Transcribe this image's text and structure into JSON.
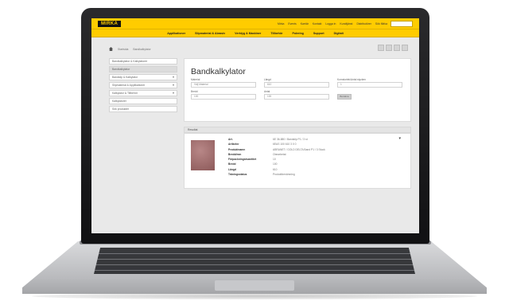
{
  "header": {
    "logo": "MIRKA",
    "top_links": [
      "Mirka",
      "Events",
      "Karriär",
      "Kontakt",
      "Logga in",
      "Kundtjänst",
      "Distributörer",
      "Sök Mirka"
    ],
    "accent_color": "#ffcc00"
  },
  "nav": {
    "items": [
      "Applikationer",
      "Slipmaterial & Abrasiv",
      "Verktyg & Maskiner",
      "Tillbehör",
      "Polering",
      "Support",
      "Digitalt"
    ]
  },
  "breadcrumb": [
    "Startsida",
    "Bandkalkylator"
  ],
  "sidebar": {
    "items": [
      {
        "label": "Bandkalkylator & Kalkylatorer",
        "chevron": false,
        "active": false
      },
      {
        "label": "Bandkalkylator",
        "chevron": false,
        "active": true
      },
      {
        "label": "Bandslip & Kalkylator",
        "chevron": true,
        "active": false
      },
      {
        "label": "Slipmaterial & Applikationer",
        "chevron": true,
        "active": false
      },
      {
        "label": "Kalkylator & Tillbehör",
        "chevron": true,
        "active": false
      },
      {
        "label": "Kalkylatorer",
        "chevron": false,
        "active": false
      },
      {
        "label": "Sök produkter",
        "chevron": false,
        "active": false
      }
    ]
  },
  "calculator": {
    "title": "Bandkalkylator",
    "labels": {
      "material": "Material",
      "width": "Bredd",
      "length": "Längd",
      "antal": "Antal",
      "kornstorlek": "Kornstorlek/Antal stycken"
    },
    "values": {
      "material": "Välj Material",
      "width": "100",
      "length": "610",
      "antal": "100",
      "kornstorlek": "1"
    },
    "button": "Beräkna"
  },
  "result": {
    "heading": "Resultat",
    "rows": [
      {
        "key": "Art.",
        "value": "6E 36-880 / Bandslip P1 / 3 st"
      },
      {
        "key": "Artikelnr",
        "value": "6EAS 100 610 3 0 0"
      },
      {
        "key": "Produktnamn",
        "value": "ABRANET / GOLD DELTA Band P1 / 3 Stuck"
      },
      {
        "key": "Bredd/mm",
        "value": "Obearbetat"
      },
      {
        "key": "Förpackningskvantitet",
        "value": "10"
      },
      {
        "key": "Bredd",
        "value": "100"
      },
      {
        "key": "Längd",
        "value": "610"
      },
      {
        "key": "Träningsstatus",
        "value": "Produktbenämning"
      }
    ]
  }
}
